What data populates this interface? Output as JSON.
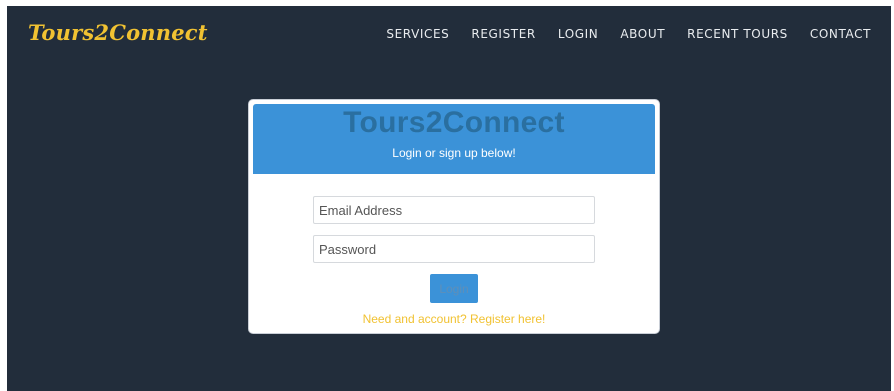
{
  "brand": "Tours2Connect",
  "nav": {
    "items": [
      "SERVICES",
      "REGISTER",
      "LOGIN",
      "ABOUT",
      "RECENT TOURS",
      "CONTACT"
    ]
  },
  "login_card": {
    "title": "Tours2Connect",
    "subtitle": "Login or sign up below!",
    "email_placeholder": "Email Address",
    "password_placeholder": "Password",
    "login_button": "Login",
    "register_link": "Need and account? Register here!"
  },
  "colors": {
    "background": "#222d3b",
    "accent_yellow": "#f1c232",
    "header_blue": "#3b92d8",
    "title_blue": "#2a6fa0"
  }
}
